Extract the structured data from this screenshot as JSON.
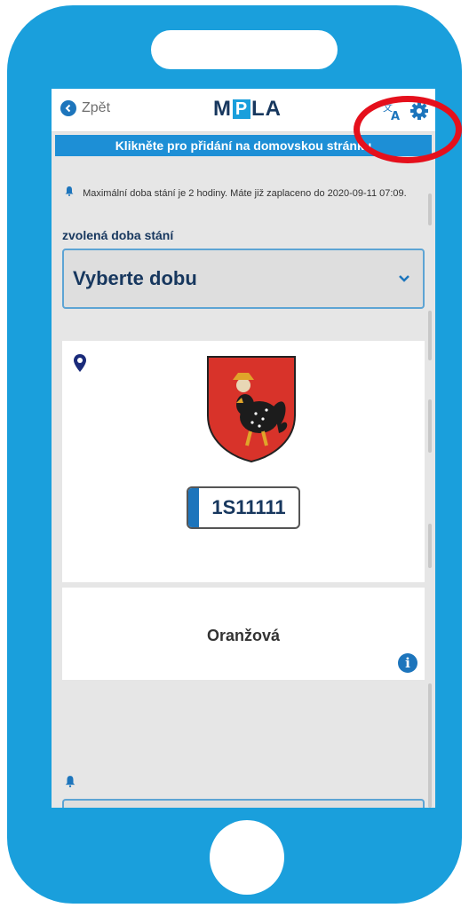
{
  "header": {
    "back_label": "Zpět",
    "logo_text_left": "M",
    "logo_text_mid": "P",
    "logo_text_right": "LA"
  },
  "banner": {
    "text": "Klikněte pro přidání na domovskou stránku"
  },
  "notice": {
    "text": "Maximální doba stání je 2 hodiny. Máte již zaplaceno do 2020-09-11 07:09."
  },
  "parking_period": {
    "label": "zvolená doba stání",
    "selected_value": "Vyberte dobu"
  },
  "vehicle": {
    "plate": "1S11111"
  },
  "zone": {
    "name": "Oranžová"
  },
  "colors": {
    "phone_frame": "#1a9fdc",
    "accent": "#1d75bc",
    "highlight_ring": "#e5101c"
  },
  "icons": [
    "back-arrow-icon",
    "translate-icon",
    "gear-icon",
    "bell-icon",
    "map-pin-icon",
    "chevron-down-icon",
    "info-icon",
    "coat-of-arms"
  ]
}
